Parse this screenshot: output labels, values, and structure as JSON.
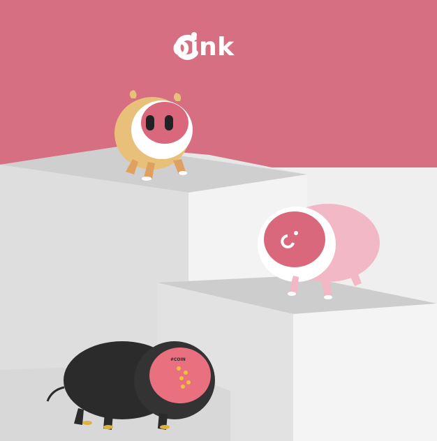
{
  "brand": {
    "logo_letter": "C",
    "wordmark": "oink",
    "full_name": "Coink"
  },
  "products": [
    {
      "name": "piggy-bank-yellow",
      "body_color": "#e8c07a",
      "face_color": "#d9687c"
    },
    {
      "name": "piggy-bank-pink",
      "body_color": "#f2b8c6",
      "face_color": "#d9687c"
    },
    {
      "name": "piggy-bank-black",
      "body_color": "#2b2b2b",
      "face_color": "#e9707f",
      "display_text": "#COIN"
    }
  ],
  "colors": {
    "backdrop": "#d66f82",
    "pedestal_light": "#f0f0f0",
    "pedestal_shadow": "#d9d9d9"
  }
}
